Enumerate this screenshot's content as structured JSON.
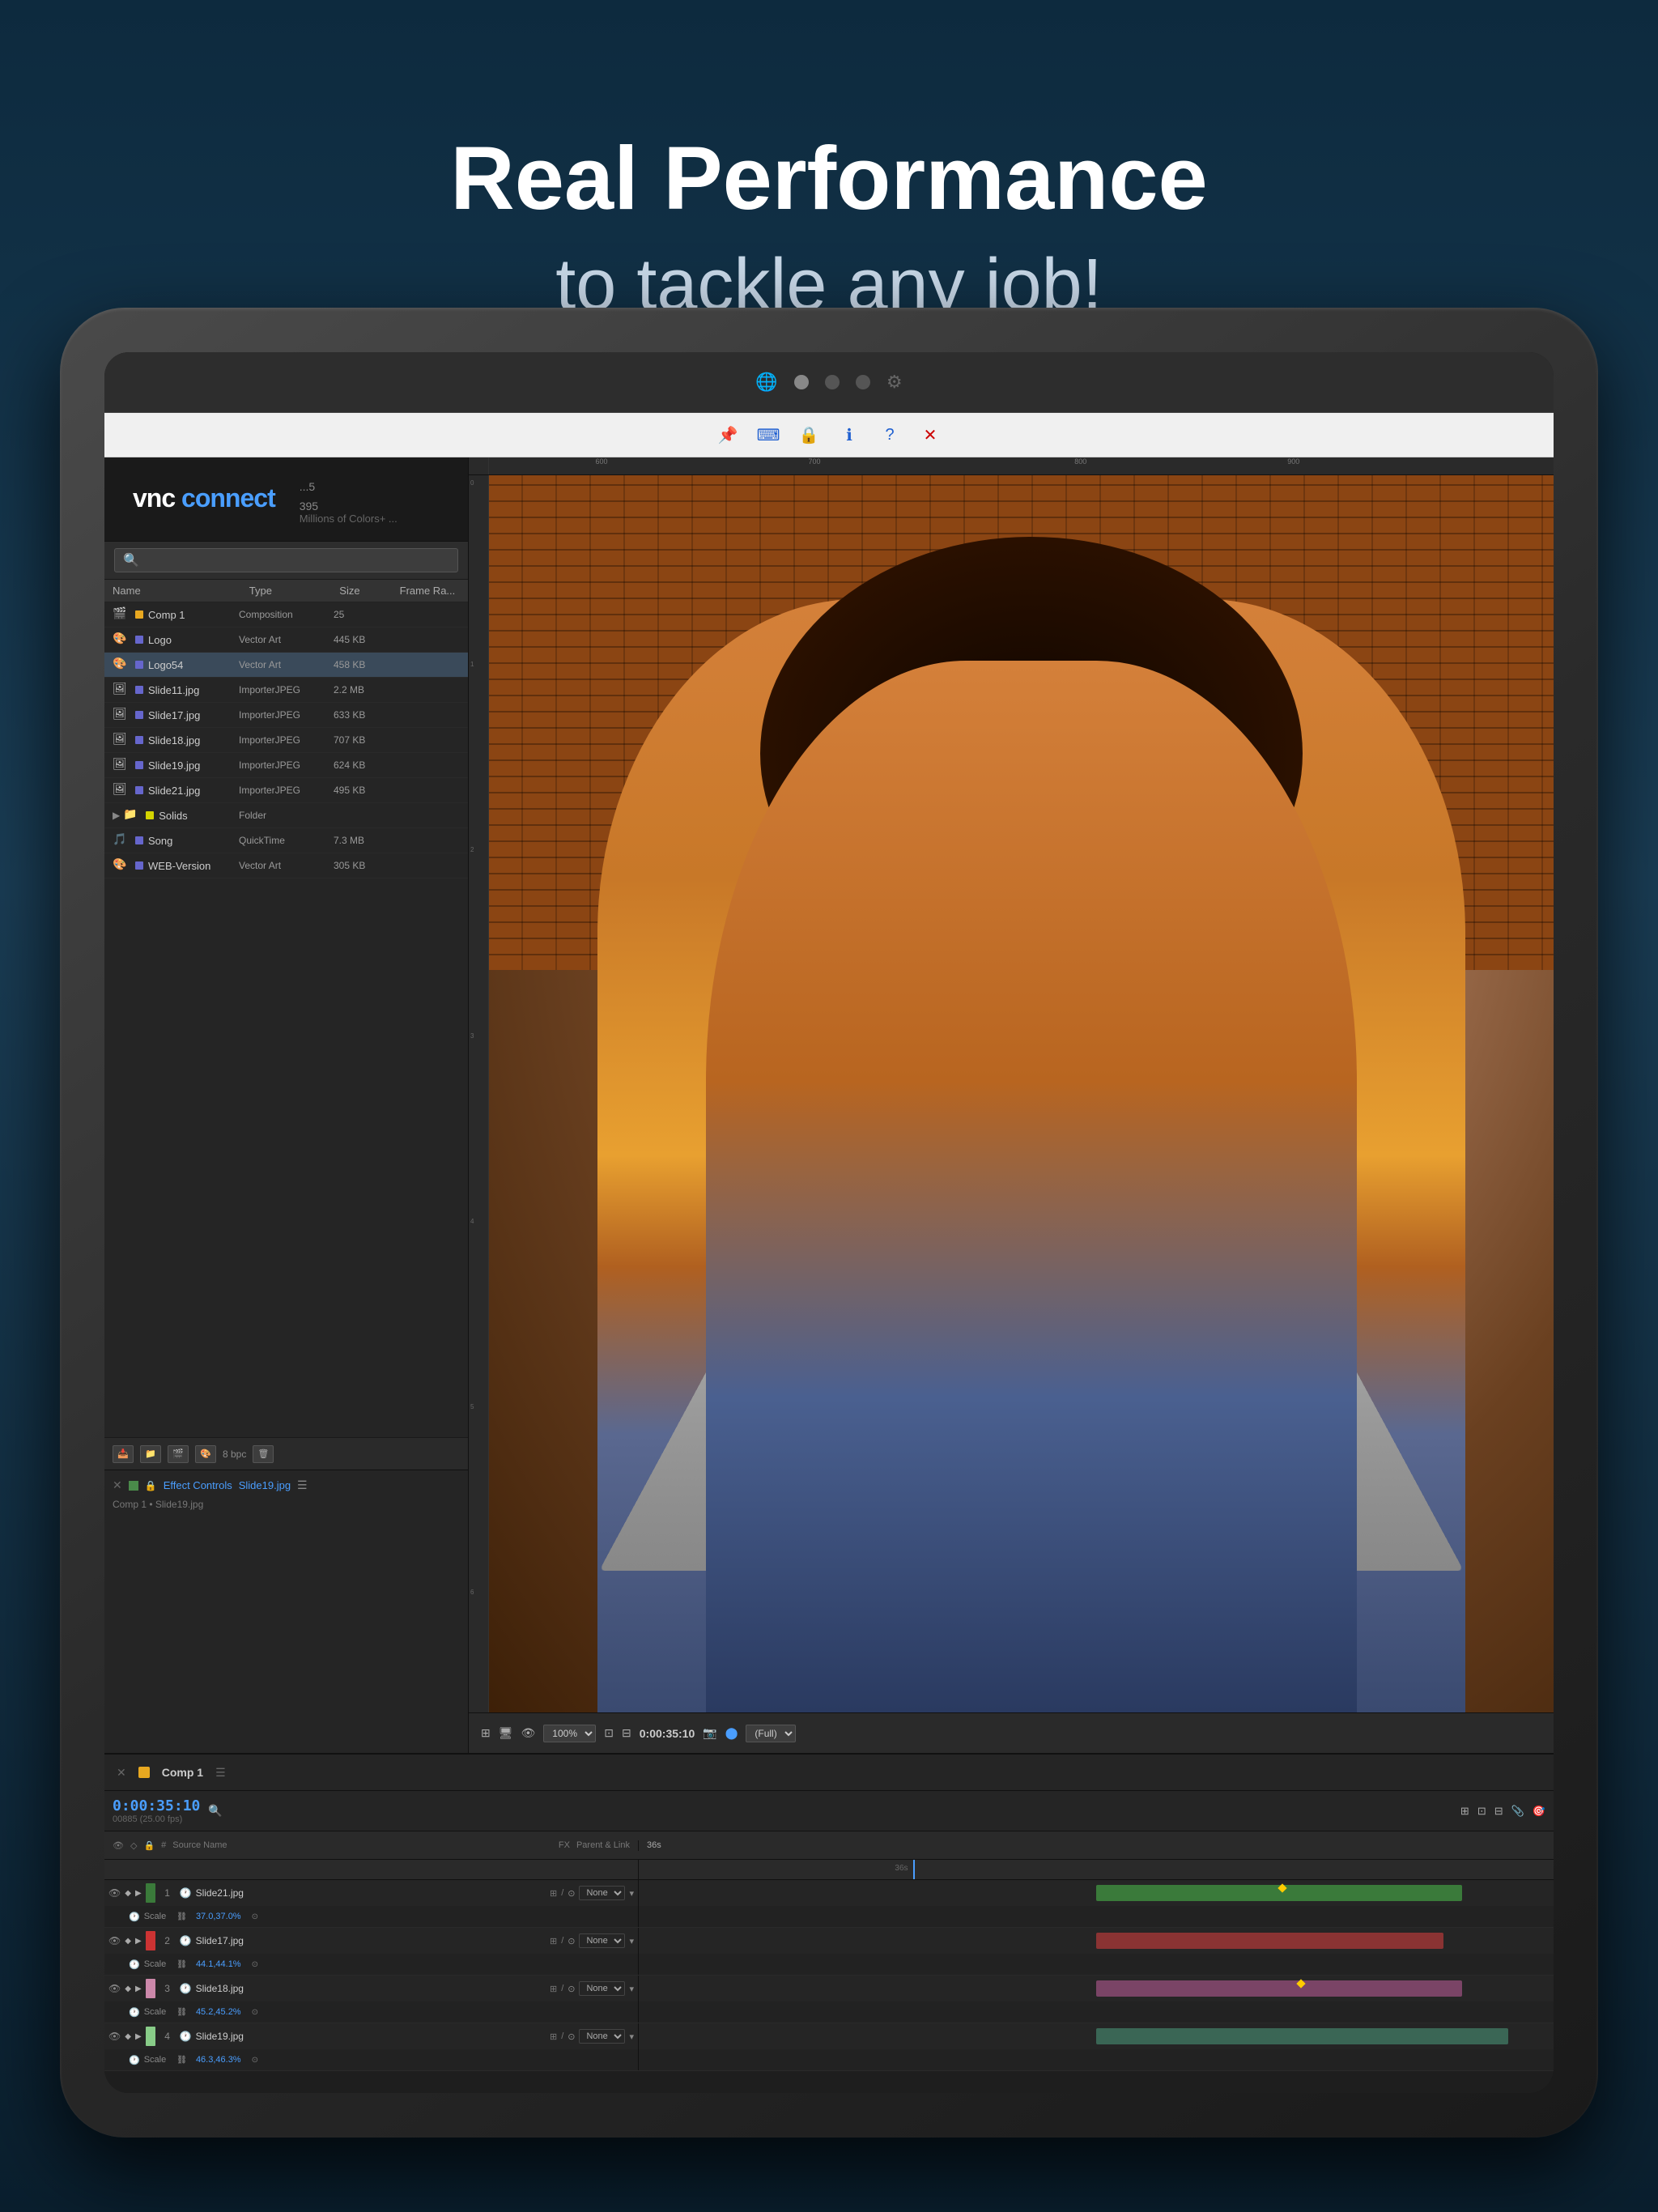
{
  "hero": {
    "title": "Real Performance",
    "subtitle": "to tackle any job!"
  },
  "browser": {
    "dots": [
      "blue",
      "gray1",
      "gray2"
    ]
  },
  "vnc_toolbar": {
    "buttons": [
      "📌",
      "⌨",
      "🔒",
      "ℹ",
      "?",
      "✕"
    ]
  },
  "vnc_logo": {
    "text": "vnc connect",
    "info_line1": "...5",
    "info_line2": "395",
    "colors_text": "Millions of Colors+ ..."
  },
  "project_panel": {
    "search_placeholder": "🔍",
    "columns": {
      "name": "Name",
      "type": "Type",
      "size": "Size",
      "framerate": "Frame Ra..."
    },
    "files": [
      {
        "name": "Comp 1",
        "icon": "🎬",
        "color": "#e8a820",
        "type": "Composition",
        "size": "25",
        "framerate": ""
      },
      {
        "name": "Logo",
        "icon": "🎨",
        "color": "#6666cc",
        "type": "Vector Art",
        "size": "445 KB",
        "framerate": ""
      },
      {
        "name": "Logo54",
        "icon": "🎨",
        "color": "#6666cc",
        "type": "Vector Art",
        "size": "458 KB",
        "framerate": ""
      },
      {
        "name": "Slide11.jpg",
        "icon": "🖼",
        "color": "#6666cc",
        "type": "ImporterJPEG",
        "size": "2.2 MB",
        "framerate": ""
      },
      {
        "name": "Slide17.jpg",
        "icon": "🖼",
        "color": "#6666cc",
        "type": "ImporterJPEG",
        "size": "633 KB",
        "framerate": ""
      },
      {
        "name": "Slide18.jpg",
        "icon": "🖼",
        "color": "#6666cc",
        "type": "ImporterJPEG",
        "size": "707 KB",
        "framerate": ""
      },
      {
        "name": "Slide19.jpg",
        "icon": "🖼",
        "color": "#6666cc",
        "type": "ImporterJPEG",
        "size": "624 KB",
        "framerate": ""
      },
      {
        "name": "Slide21.jpg",
        "icon": "🖼",
        "color": "#6666cc",
        "type": "ImporterJPEG",
        "size": "495 KB",
        "framerate": ""
      },
      {
        "name": "Solids",
        "icon": "📁",
        "color": "#d4d400",
        "type": "Folder",
        "size": "",
        "framerate": ""
      },
      {
        "name": "Song",
        "icon": "🎵",
        "color": "#6666cc",
        "type": "QuickTime",
        "size": "7.3 MB",
        "framerate": ""
      },
      {
        "name": "WEB-Version",
        "icon": "🎨",
        "color": "#6666cc",
        "type": "Vector Art",
        "size": "305 KB",
        "framerate": ""
      }
    ],
    "bottom_bpc": "8 bpc"
  },
  "effect_controls": {
    "title": "Effect Controls",
    "file": "Slide19.jpg",
    "comp_path": "Comp 1 • Slide19.jpg"
  },
  "viewer": {
    "zoom": "100%",
    "time": "0:00:35:10",
    "quality": "(Full)"
  },
  "timeline": {
    "comp_name": "Comp 1",
    "time": "0:00:35:10",
    "frames": "00885 (25.00 fps)",
    "scale_marks": [
      "36s"
    ],
    "layers": [
      {
        "num": "1",
        "color": "#3a7a3a",
        "name": "Slide21.jpg",
        "sub_label": "Scale",
        "sub_value": "37.0,37.0%",
        "parent": "None",
        "bar_color": "#3a7a3a",
        "bar_left": "50%",
        "bar_width": "40%",
        "kf_pos": "70%"
      },
      {
        "num": "2",
        "color": "#cc3333",
        "name": "Slide17.jpg",
        "sub_label": "Scale",
        "sub_value": "44.1,44.1%",
        "parent": "None",
        "bar_color": "#8a3333",
        "bar_left": "50%",
        "bar_width": "38%"
      },
      {
        "num": "3",
        "color": "#cc88aa",
        "name": "Slide18.jpg",
        "sub_label": "Scale",
        "sub_value": "45.2,45.2%",
        "parent": "None",
        "bar_color": "#7a4466",
        "bar_left": "50%",
        "bar_width": "40%",
        "kf_pos": "72%"
      },
      {
        "num": "4",
        "color": "#88cc88",
        "name": "Slide19.jpg",
        "sub_label": "Scale",
        "sub_value": "46.3,46.3%",
        "parent": "None",
        "bar_color": "#3a6655",
        "bar_left": "50%",
        "bar_width": "45%"
      }
    ]
  }
}
